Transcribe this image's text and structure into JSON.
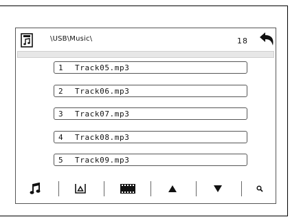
{
  "header": {
    "path": "\\USB\\Music\\",
    "count": "18"
  },
  "tracks": [
    {
      "num": "1",
      "name": "Track05.mp3"
    },
    {
      "num": "2",
      "name": "Track06.mp3"
    },
    {
      "num": "3",
      "name": "Track07.mp3"
    },
    {
      "num": "4",
      "name": "Track08.mp3"
    },
    {
      "num": "5",
      "name": "Track09.mp3"
    }
  ],
  "icons": {
    "header_left": "music-file-icon",
    "header_right": "back-arrow-icon",
    "toolbar": [
      "music-note-icon",
      "usb-icon",
      "video-film-icon",
      "page-up-icon",
      "page-down-icon",
      "search-icon"
    ]
  },
  "colors": {
    "foreground": "#111111",
    "info_bar": "#e7e7e7"
  }
}
